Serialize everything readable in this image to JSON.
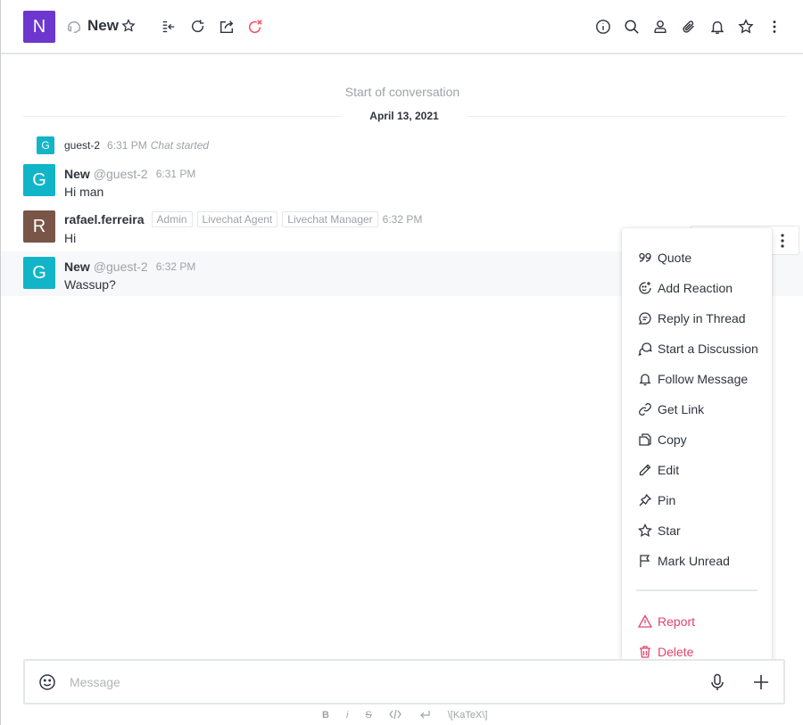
{
  "header": {
    "avatar_letter": "N",
    "avatar_color": "#6c36cf",
    "room_name": "New",
    "room_type_icon": "headset-icon",
    "left_icons": [
      "favorite-star-icon",
      "enter-room-icon",
      "forward-icon",
      "transfer-icon",
      "close-chat-icon"
    ],
    "right_icons": [
      "info-icon",
      "search-icon",
      "user-icon",
      "attachment-icon",
      "bell-icon",
      "star-icon",
      "kebab-icon"
    ]
  },
  "conversation": {
    "start_label": "Start of conversation",
    "date": "April 13, 2021"
  },
  "system_message": {
    "avatar_letter": "G",
    "username": "guest-2",
    "time": "6:31 PM",
    "text": "Chat started"
  },
  "messages": [
    {
      "avatar_letter": "G",
      "avatar_color": "#12b5c7",
      "name": "New",
      "handle": "@guest-2",
      "roles": [],
      "time": "6:31 PM",
      "text": "Hi man"
    },
    {
      "avatar_letter": "R",
      "avatar_color": "#795548",
      "name": "rafael.ferreira",
      "handle": "",
      "roles": [
        "Admin",
        "Livechat Agent",
        "Livechat Manager"
      ],
      "time": "6:32 PM",
      "text": "Hi"
    },
    {
      "avatar_letter": "G",
      "avatar_color": "#12b5c7",
      "name": "New",
      "handle": "@guest-2",
      "roles": [],
      "time": "6:32 PM",
      "text": "Wassup?"
    }
  ],
  "menu": {
    "items": [
      {
        "label": "Quote",
        "icon": "quote-icon"
      },
      {
        "label": "Add Reaction",
        "icon": "add-reaction-icon"
      },
      {
        "label": "Reply in Thread",
        "icon": "thread-icon"
      },
      {
        "label": "Start a Discussion",
        "icon": "discussion-icon"
      },
      {
        "label": "Follow Message",
        "icon": "bell-icon"
      },
      {
        "label": "Get Link",
        "icon": "link-icon"
      },
      {
        "label": "Copy",
        "icon": "copy-icon"
      },
      {
        "label": "Edit",
        "icon": "pencil-icon"
      },
      {
        "label": "Pin",
        "icon": "pin-icon"
      },
      {
        "label": "Star",
        "icon": "star-icon"
      },
      {
        "label": "Mark Unread",
        "icon": "flag-icon"
      }
    ],
    "danger_items": [
      {
        "label": "Report",
        "icon": "warning-icon"
      },
      {
        "label": "Delete",
        "icon": "trash-icon"
      }
    ]
  },
  "composer": {
    "placeholder": "Message",
    "format_bold": "B",
    "format_italic": "i",
    "format_strike": "S",
    "format_katex": "\\[KaTeX\\]"
  },
  "colors": {
    "accent": "#6c36cf",
    "guest_avatar": "#12b5c7",
    "agent_avatar": "#795548",
    "danger": "#e4446b",
    "close_icon": "#f5455c"
  }
}
